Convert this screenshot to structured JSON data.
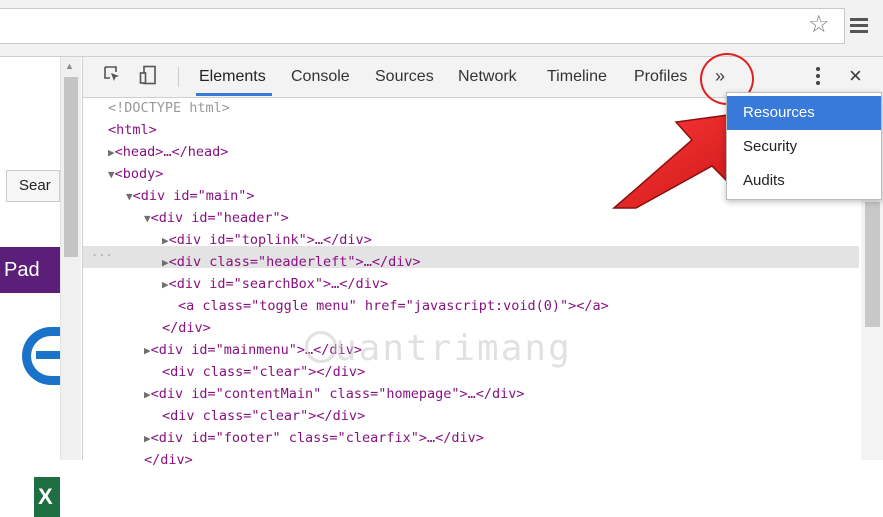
{
  "browser": {
    "star_icon": "star-icon",
    "menu_icon": "hamburger-menu-icon"
  },
  "page": {
    "search_label": "Sear",
    "banner_text": "Pad",
    "excel_letter": "X"
  },
  "devtools": {
    "tabs": [
      "Elements",
      "Console",
      "Sources",
      "Network",
      "Timeline",
      "Profiles"
    ],
    "active_tab": "Elements",
    "more_label": "»",
    "close_label": "×",
    "accent": "#3879d9",
    "code_lines": [
      "<!DOCTYPE html>",
      "<html>",
      "<head>…</head>",
      "<body>",
      "<div id=\"main\">",
      "<div id=\"header\">",
      "<div id=\"toplink\">…</div>",
      "<div class=\"headerleft\">…</div>",
      "<div id=\"searchBox\">…</div>",
      "<a class=\"toggle menu\" href=\"javascript:void(0)\"></a>",
      "</div>",
      "<div id=\"mainmenu\">…</div>",
      "<div class=\"clear\"></div>",
      "<div id=\"contentMain\" class=\"homepage\">…</div>",
      "<div class=\"clear\"></div>",
      "<div id=\"footer\" class=\"clearfix\">…</div>",
      "</div>"
    ],
    "dots": "..."
  },
  "dropdown": {
    "items": [
      "Resources",
      "Security",
      "Audits"
    ],
    "selected": "Resources"
  },
  "watermark": "uantrimang"
}
